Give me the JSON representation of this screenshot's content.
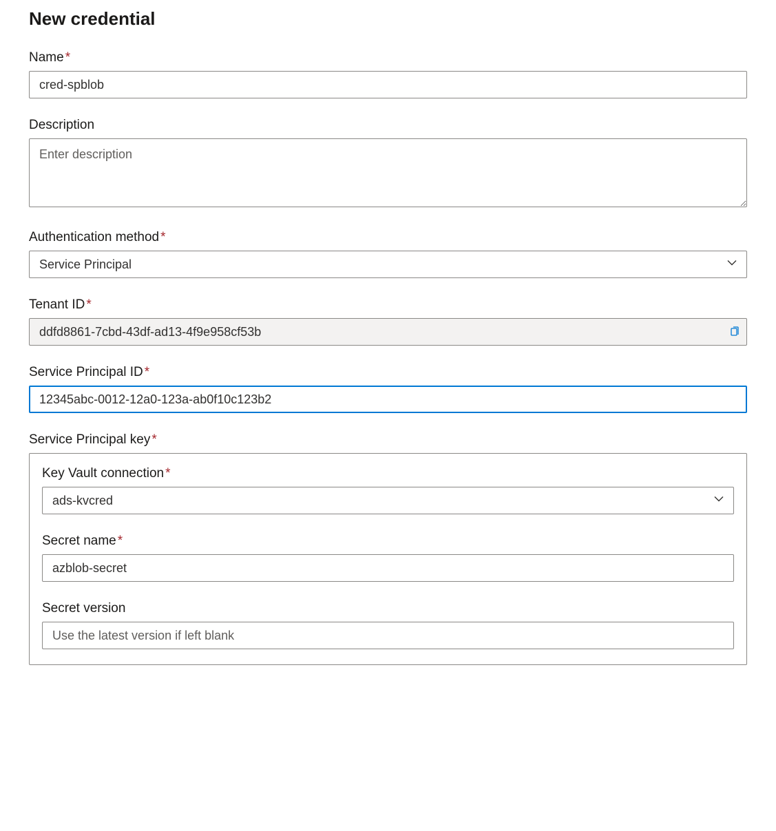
{
  "page": {
    "title": "New credential"
  },
  "form": {
    "name": {
      "label": "Name",
      "required": true,
      "value": "cred-spblob"
    },
    "description": {
      "label": "Description",
      "required": false,
      "placeholder": "Enter description",
      "value": ""
    },
    "auth_method": {
      "label": "Authentication method",
      "required": true,
      "selected": "Service Principal"
    },
    "tenant_id": {
      "label": "Tenant ID",
      "required": true,
      "value": "ddfd8861-7cbd-43df-ad13-4f9e958cf53b"
    },
    "sp_id": {
      "label": "Service Principal ID",
      "required": true,
      "value": "12345abc-0012-12a0-123a-ab0f10c123b2"
    },
    "sp_key": {
      "label": "Service Principal key",
      "required": true,
      "kv_connection": {
        "label": "Key Vault connection",
        "required": true,
        "selected": "ads-kvcred"
      },
      "secret_name": {
        "label": "Secret name",
        "required": true,
        "value": "azblob-secret"
      },
      "secret_version": {
        "label": "Secret version",
        "required": false,
        "placeholder": "Use the latest version if left blank",
        "value": ""
      }
    }
  }
}
